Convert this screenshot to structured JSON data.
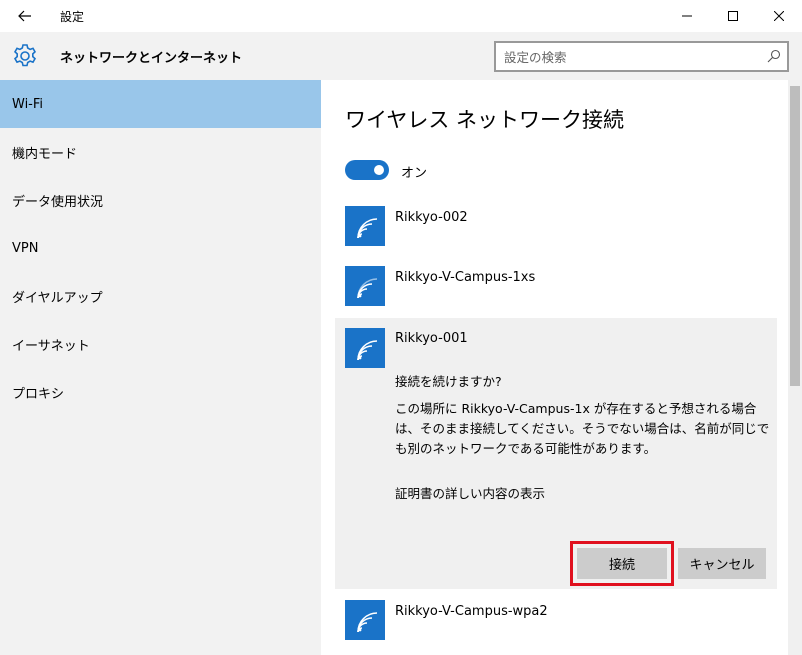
{
  "window": {
    "title": "設定"
  },
  "header": {
    "section_title": "ネットワークとインターネット",
    "search_placeholder": "設定の検索"
  },
  "sidebar": {
    "items": [
      {
        "label": "Wi-Fi",
        "active": true
      },
      {
        "label": "機内モード"
      },
      {
        "label": "データ使用状況"
      },
      {
        "label": "VPN"
      },
      {
        "label": "ダイヤルアップ"
      },
      {
        "label": "イーサネット"
      },
      {
        "label": "プロキシ"
      }
    ]
  },
  "main": {
    "title": "ワイヤレス ネットワーク接続",
    "wifi_toggle": {
      "label": "オン",
      "on": true
    },
    "networks": [
      {
        "name": "Rikkyo-002"
      },
      {
        "name": "Rikkyo-V-Campus-1xs"
      },
      {
        "name": "Rikkyo-001",
        "expanded": true,
        "prompt": "接続を続けますか?",
        "message": "この場所に Rikkyo-V-Campus-1x が存在すると予想される場合は、そのまま接続してください。そうでない場合は、名前が同じでも別のネットワークである可能性があります。",
        "cert_link": "証明書の詳しい内容の表示",
        "connect_label": "接続",
        "cancel_label": "キャンセル"
      },
      {
        "name": "Rikkyo-V-Campus-wpa2"
      }
    ]
  },
  "colors": {
    "accent": "#1a73c8",
    "sidebar_active": "#99c6ea",
    "highlight": "#e0101e"
  }
}
